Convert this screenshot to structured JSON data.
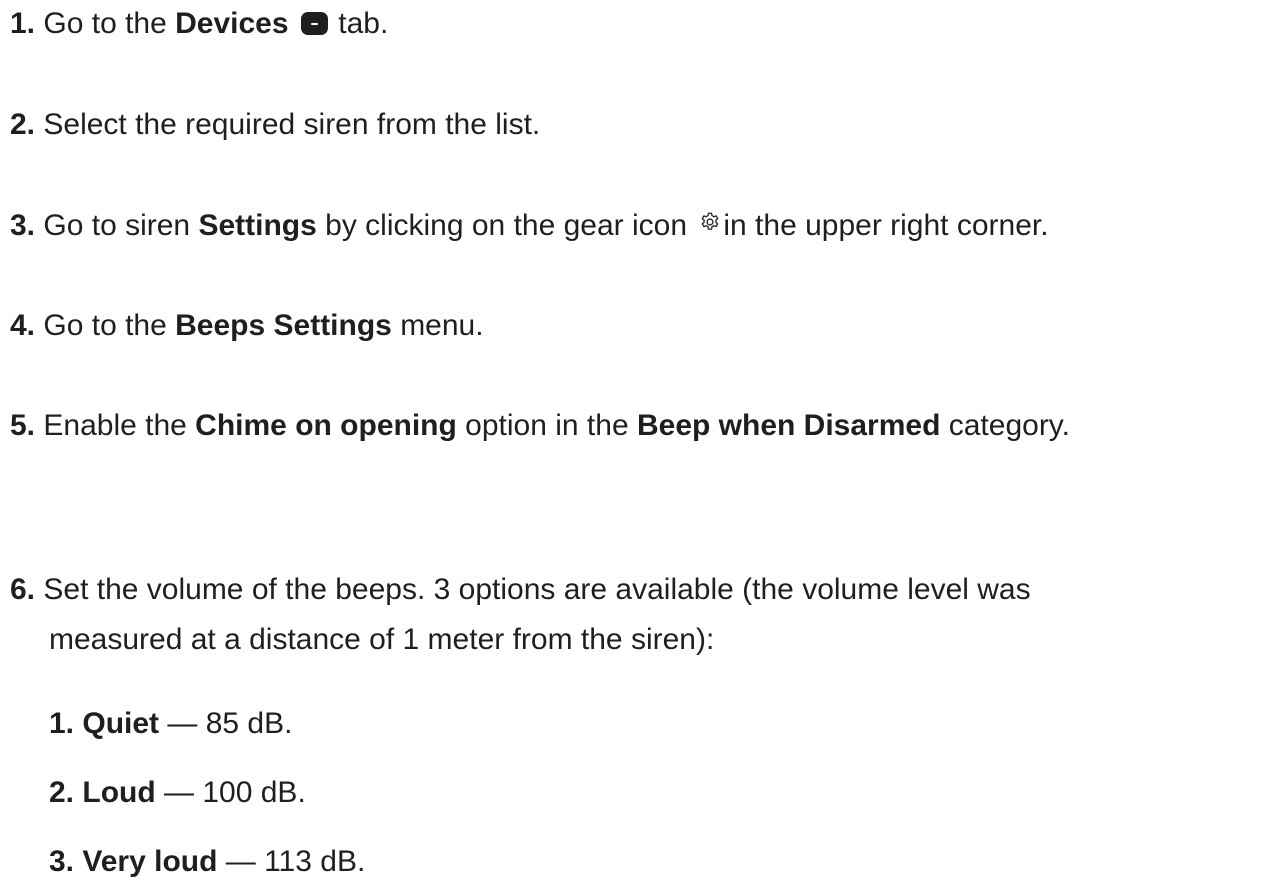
{
  "steps": [
    {
      "num": "1.",
      "parts": [
        "Go to the ",
        "Devices",
        "tab."
      ],
      "icon": "devices-tab-icon"
    },
    {
      "num": "2.",
      "text": "Select the required siren from the list."
    },
    {
      "num": "3.",
      "parts": [
        "Go to siren ",
        "Settings",
        " by clicking on the gear icon ",
        "in the upper right corner."
      ],
      "icon": "gear-icon"
    },
    {
      "num": "4.",
      "parts": [
        "Go to the ",
        "Beeps Settings",
        " menu."
      ]
    },
    {
      "num": "5.",
      "parts": [
        "Enable the ",
        "Chime on opening",
        " option in the ",
        "Beep when Disarmed",
        " category."
      ]
    },
    {
      "num": "6.",
      "line1": "Set the volume of the beeps. 3 options are available (the volume level was",
      "line2": "measured at a distance of 1 meter from the siren):"
    }
  ],
  "volume_options": [
    {
      "num": "1.",
      "name": "Quiet",
      "value": " — 85 dB."
    },
    {
      "num": "2.",
      "name": "Loud",
      "value": " — 100 dB."
    },
    {
      "num": "3.",
      "name": "Very loud",
      "value": " — 113 dB."
    }
  ]
}
